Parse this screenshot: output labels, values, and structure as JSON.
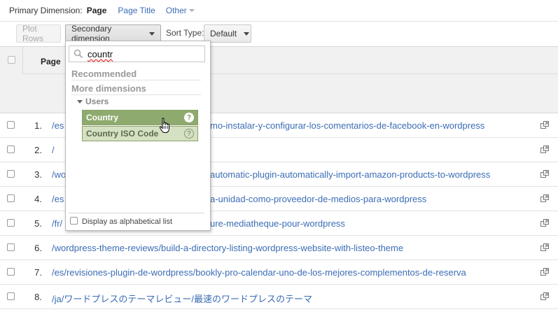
{
  "primary_dimension": {
    "label": "Primary Dimension:",
    "active": "Page",
    "options": [
      "Page Title",
      "Other"
    ]
  },
  "toolbar": {
    "plot_rows": "Plot Rows",
    "secondary_dimension": "Secondary dimension",
    "sort_type_label": "Sort Type:",
    "sort_type_value": "Default"
  },
  "table": {
    "header": "Page",
    "rows": [
      {
        "num": "1.",
        "url": "/es",
        "url_tail": "mo-instalar-y-configurar-los-comentarios-de-facebook-en-wordpress"
      },
      {
        "num": "2.",
        "url": "/",
        "url_tail": ""
      },
      {
        "num": "3.",
        "url": "/wo",
        "url_tail": "automatic-plugin-automatically-import-amazon-products-to-wordpress"
      },
      {
        "num": "4.",
        "url": "/es",
        "url_tail": "a-unidad-como-proveedor-de-medios-para-wordpress"
      },
      {
        "num": "5.",
        "url": "/fr/",
        "url_tail": "ure-mediatheque-pour-wordpress"
      },
      {
        "num": "6.",
        "url": "/wordpress-theme-reviews/build-a-directory-listing-wordpress-website-with-listeo-theme",
        "url_tail": ""
      },
      {
        "num": "7.",
        "url": "/es/revisiones-plugin-de-wordpress/bookly-pro-calendar-uno-de-los-mejores-complementos-de-reserva",
        "url_tail": ""
      },
      {
        "num": "8.",
        "url": "/ja/ワードプレスのテーマレビュー/最速のワードプレスのテーマ",
        "url_tail": ""
      }
    ]
  },
  "dropdown": {
    "search_value": "countr",
    "recommended": "Recommended",
    "more_dimensions": "More dimensions",
    "group": "Users",
    "options": [
      {
        "label": "Country",
        "help": "?"
      },
      {
        "label": "Country ISO Code",
        "help": "?"
      }
    ],
    "alphabetical_label": "Display as alphabetical list"
  },
  "colors": {
    "link": "#3b6db5",
    "selected_option": "#8faa6e",
    "option": "#d5e1c3"
  }
}
